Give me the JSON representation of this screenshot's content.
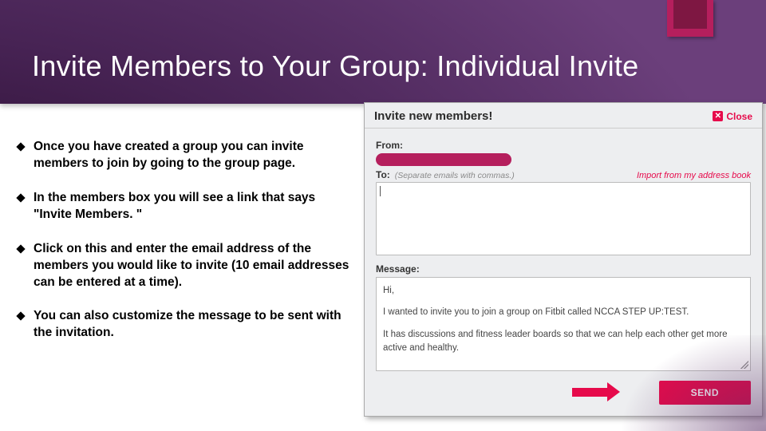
{
  "title": "Invite Members to Your Group: Individual Invite",
  "bullets": [
    "Once you have created a group you can invite members to join by going to the group page.",
    "In the members box you will see a link that says \"Invite Members. \"",
    "Click on this and enter the email address of the members you would like to invite (10 email addresses can be entered at a time).",
    "You can also customize the message to be sent with the invitation."
  ],
  "modal": {
    "title": "Invite new members!",
    "close_label": "Close",
    "from_label": "From:",
    "to_label": "To:",
    "to_hint": "(Separate emails with commas.)",
    "import_link": "Import from my address book",
    "message_label": "Message:",
    "message_lines": {
      "greeting": "Hi,",
      "line1": "I wanted to invite you to join a group on Fitbit called NCCA STEP UP:TEST.",
      "line2": "It has discussions and fitness leader boards so that we can help each other get more active and healthy."
    },
    "send_label": "SEND"
  }
}
